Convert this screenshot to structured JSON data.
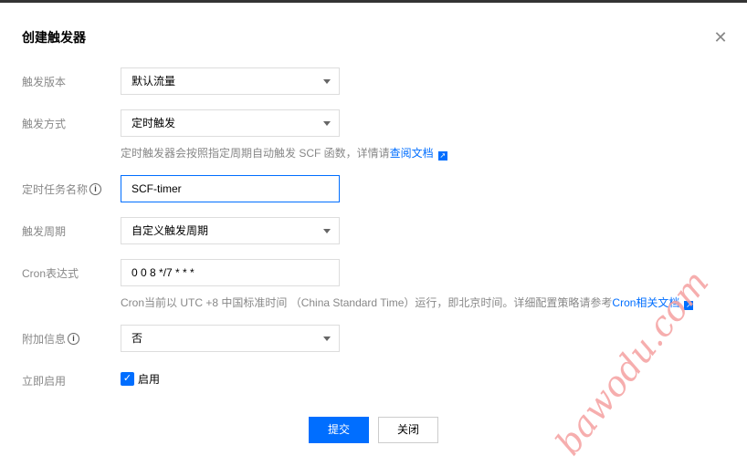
{
  "dialog": {
    "title": "创建触发器",
    "close_icon": "close-icon"
  },
  "form": {
    "version": {
      "label": "触发版本",
      "value": "默认流量"
    },
    "method": {
      "label": "触发方式",
      "value": "定时触发",
      "help": "定时触发器会按照指定周期自动触发 SCF 函数，详情请",
      "help_link": "查阅文档"
    },
    "task_name": {
      "label": "定时任务名称",
      "value": "SCF-timer"
    },
    "period": {
      "label": "触发周期",
      "value": "自定义触发周期"
    },
    "cron": {
      "label": "Cron表达式",
      "value": "0 0 8 */7 * * *",
      "help": "Cron当前以 UTC +8 中国标准时间 （China Standard Time）运行，即北京时间。详细配置策略请参考",
      "help_link": "Cron相关文档"
    },
    "extra": {
      "label": "附加信息",
      "value": "否"
    },
    "enable": {
      "label": "立即启用",
      "checkbox_label": "启用",
      "checked": true
    }
  },
  "buttons": {
    "submit": "提交",
    "close": "关闭"
  },
  "watermark": "bawodu.com",
  "colors": {
    "accent": "#006eff",
    "watermark": "#f5a0a0"
  }
}
